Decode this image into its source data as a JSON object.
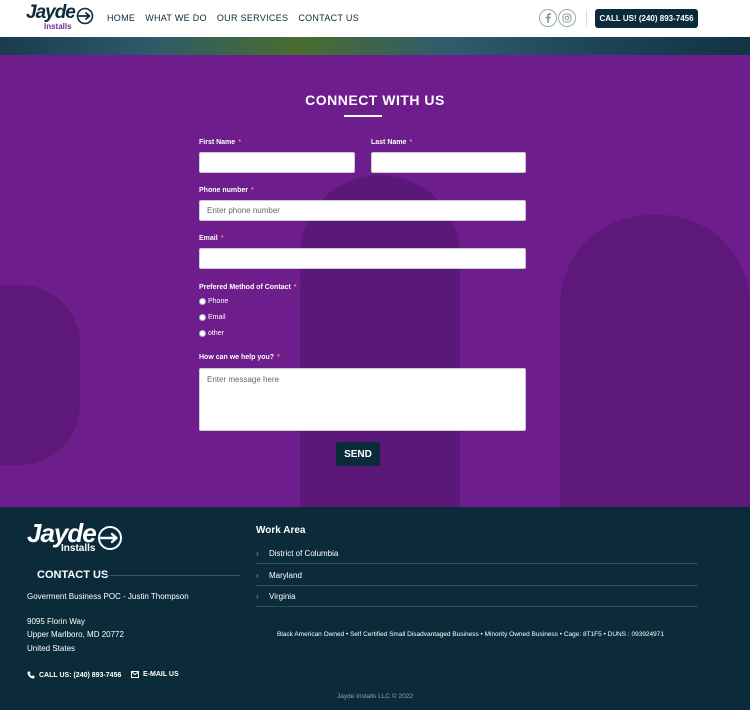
{
  "header": {
    "logo_text": "Jayde",
    "logo_sub": "Installs",
    "nav": [
      "HOME",
      "WHAT WE DO",
      "OUR SERVICES",
      "CONTACT US"
    ],
    "social": [
      "facebook-icon",
      "instagram-icon"
    ],
    "call_button": "CALL US! (240) 893-7456"
  },
  "form": {
    "title": "CONNECT WITH US",
    "first_name_label": "First Name",
    "last_name_label": "Last Name",
    "phone_label": "Phone number",
    "phone_placeholder": "Enter phone number",
    "email_label": "Email",
    "method_label": "Prefered Method of Contact",
    "methods": [
      "Phone",
      "Email",
      "other"
    ],
    "help_label": "How can we help you?",
    "help_placeholder": "Enter message here",
    "required_mark": "*",
    "send_label": "SEND"
  },
  "footer": {
    "logo_text": "Jayde",
    "logo_sub": "Installs",
    "contact_title": "CONTACT US",
    "poc": "Goverment Business POC - Justin Thompson",
    "address_line1": "9095 Florin Way",
    "address_line2": "Upper Marlboro, MD 20772",
    "address_line3": "United States",
    "call_link": "CALL US: (240) 893-7456",
    "email_link": "E-MAIL US",
    "work_title": "Work Area",
    "work_areas": [
      "District of Columbia",
      "Maryland",
      "Virginia"
    ],
    "certifications": "Black American Owned • Self Certified Small Disadvantaged Business • Minority Owned Business • Cage: 8T1F5 • DUNS : 093924971",
    "copyright": "Jayde Installs LLC © 2022"
  },
  "colors": {
    "primary": "#0b2a3a",
    "purple": "#6e1d8c",
    "accent": "#7b2a90"
  }
}
